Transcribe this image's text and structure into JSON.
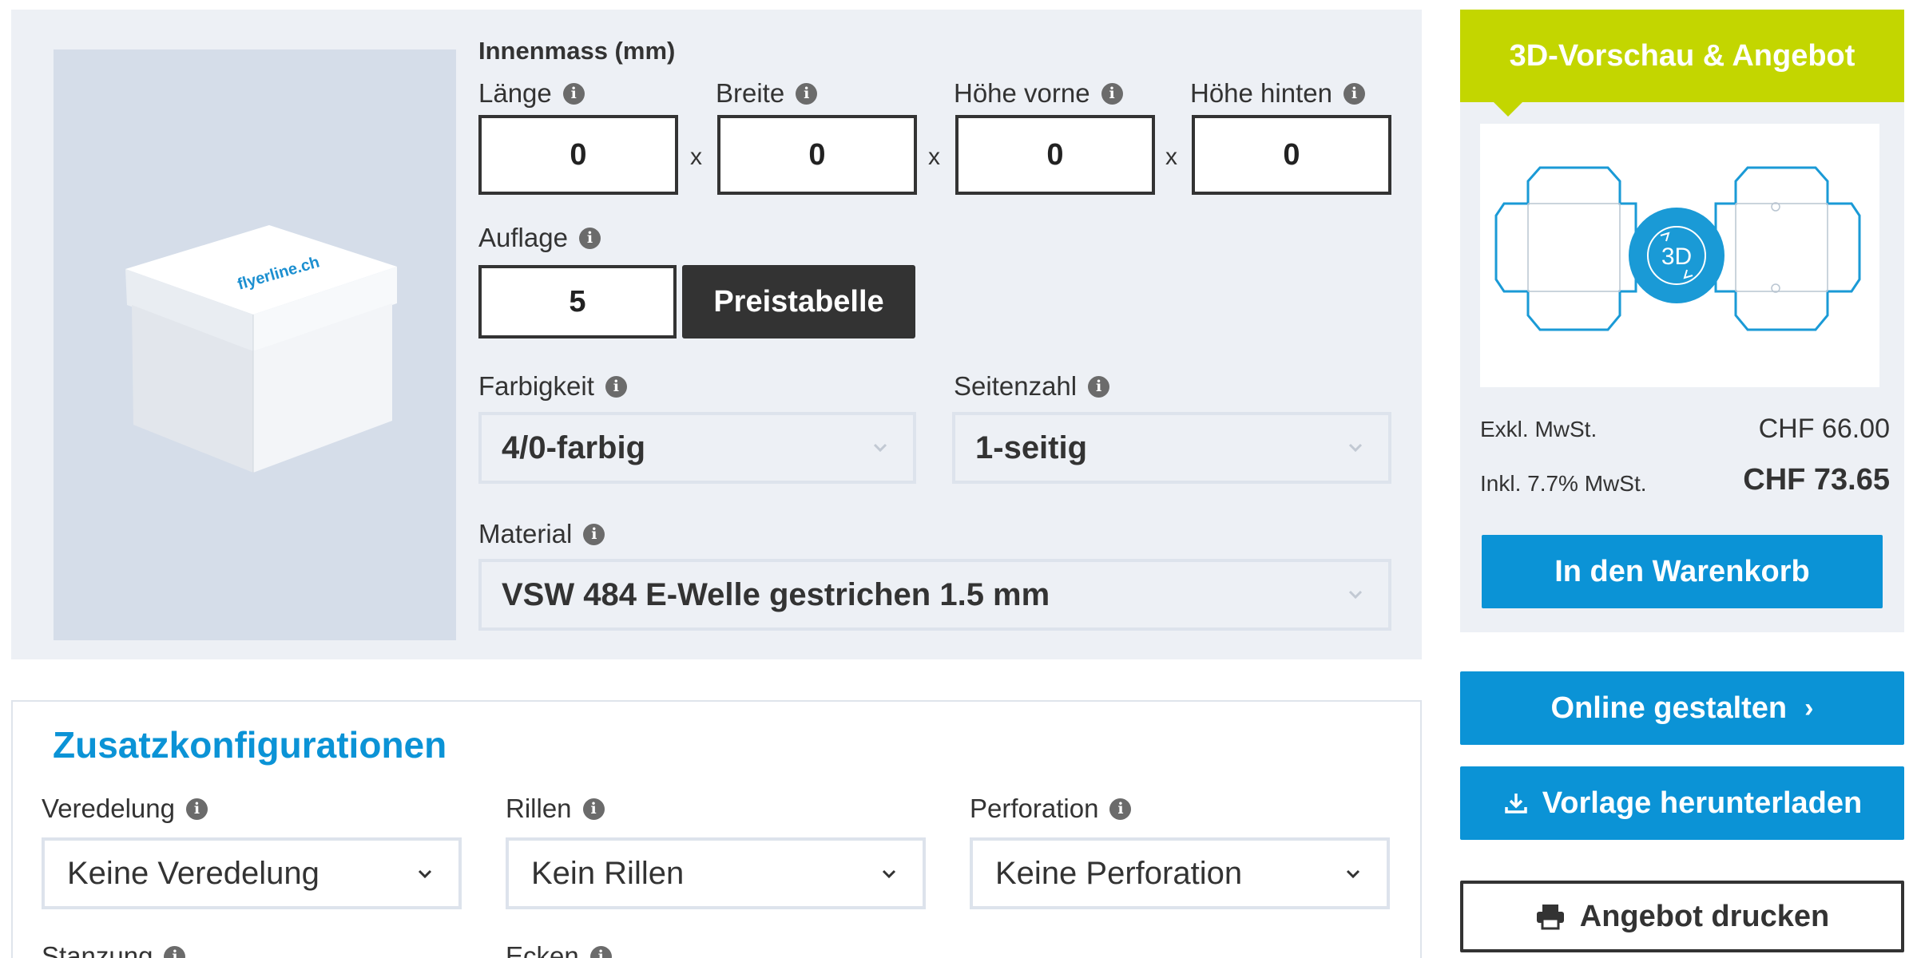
{
  "config": {
    "inner_size_label": "Innenmass (mm)",
    "dimensions": [
      {
        "label": "Länge",
        "value": "0"
      },
      {
        "label": "Breite",
        "value": "0"
      },
      {
        "label": "Höhe vorne",
        "value": "0"
      },
      {
        "label": "Höhe hinten",
        "value": "0"
      }
    ],
    "times_symbol": "x",
    "quantity": {
      "label": "Auflage",
      "value": "5",
      "price_table_button": "Preistabelle"
    },
    "color": {
      "label": "Farbigkeit",
      "value": "4/0-farbig"
    },
    "pages": {
      "label": "Seitenzahl",
      "value": "1-seitig"
    },
    "material": {
      "label": "Material",
      "value": "VSW 484 E-Welle gestrichen 1.5 mm"
    },
    "product_image_logo": "flyerline.ch"
  },
  "extras": {
    "title": "Zusatzkonfigurationen",
    "finishing": {
      "label": "Veredelung",
      "value": "Keine Veredelung"
    },
    "creasing": {
      "label": "Rillen",
      "value": "Kein Rillen"
    },
    "perforation": {
      "label": "Perforation",
      "value": "Keine Perforation"
    },
    "punching": {
      "label": "Stanzung"
    },
    "corners": {
      "label": "Ecken"
    }
  },
  "offer": {
    "title": "3D-Vorschau & Angebot",
    "badge_3d": "3D",
    "price_excl_label": "Exkl. MwSt.",
    "price_excl": "CHF 66.00",
    "price_incl_label": "Inkl. 7.7% MwSt.",
    "price_incl": "CHF 73.65",
    "add_to_cart": "In den Warenkorb"
  },
  "actions": {
    "design_online": "Online gestalten",
    "design_online_arrow": "›",
    "download_template": "Vorlage herunterladen",
    "print_offer": "Angebot drucken"
  },
  "colors": {
    "accent_blue": "#0b93d6",
    "accent_green": "#c3d600",
    "dark": "#333333",
    "panel_bg": "#edf0f5"
  }
}
